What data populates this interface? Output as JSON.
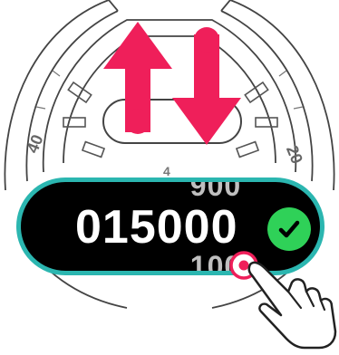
{
  "instruction_screen": {
    "value_picker": {
      "previous_value": "900",
      "current_value": "015000",
      "next_value": "100"
    },
    "icons": {
      "sync": "sync-arrows-icon",
      "confirm": "checkmark-icon",
      "crown": "crown-target-icon",
      "hand": "pointing-hand-icon"
    },
    "colors": {
      "accent_pink": "#ef1f5a",
      "teal_border": "#2bb6b0",
      "check_green": "#2fd158"
    }
  }
}
